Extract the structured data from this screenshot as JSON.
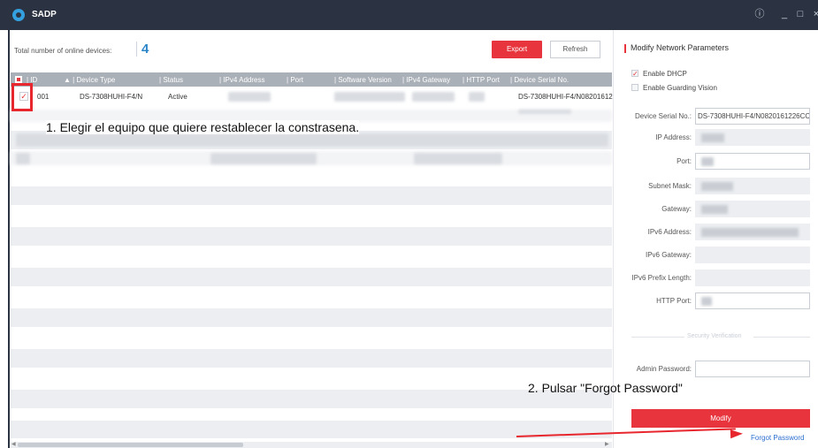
{
  "titlebar": {
    "app_name": "SADP",
    "info_icon": "info-icon",
    "minimize_icon": "minimize-icon",
    "maximize_icon": "maximize-icon"
  },
  "toolbar": {
    "total_label": "Total number of online devices:",
    "total_count": "4",
    "export_label": "Export",
    "refresh_label": "Refresh"
  },
  "table": {
    "headers": [
      "ID",
      "Device Type",
      "Status",
      "IPv4 Address",
      "Port",
      "Software Version",
      "IPv4 Gateway",
      "HTTP Port",
      "Device Serial No."
    ],
    "sort_indicator": "▲",
    "rows": [
      {
        "id": "001",
        "device_type": "DS-7308HUHI-F4/N",
        "status": "Active",
        "serial": "DS-7308HUHI-F4/N08201612",
        "checked": true
      }
    ]
  },
  "annotations": {
    "step1": "1. Elegir el equipo que quiere restablecer la constrasena.",
    "step2": "2. Pulsar \"Forgot Password\""
  },
  "panel": {
    "title": "Modify Network Parameters",
    "enable_dhcp": "Enable DHCP",
    "enable_dhcp_checked": true,
    "enable_guarding": "Enable Guarding Vision",
    "enable_guarding_checked": false,
    "fields": {
      "serial_label": "Device Serial No.:",
      "serial_value": "DS-7308HUHI-F4/N0820161226CC",
      "ip_label": "IP Address:",
      "port_label": "Port:",
      "subnet_label": "Subnet Mask:",
      "gateway_label": "Gateway:",
      "ipv6_label": "IPv6 Address:",
      "ipv6_gw_label": "IPv6 Gateway:",
      "ipv6_prefix_label": "IPv6 Prefix Length:",
      "http_port_label": "HTTP Port:"
    },
    "security_label": "Security Verification",
    "admin_password_label": "Admin Password:",
    "modify_label": "Modify",
    "forgot_label": "Forgot Password"
  },
  "colors": {
    "accent": "#e8353d",
    "titlebar": "#2b3342",
    "link": "#2c6fd0",
    "count": "#2c86c8"
  }
}
